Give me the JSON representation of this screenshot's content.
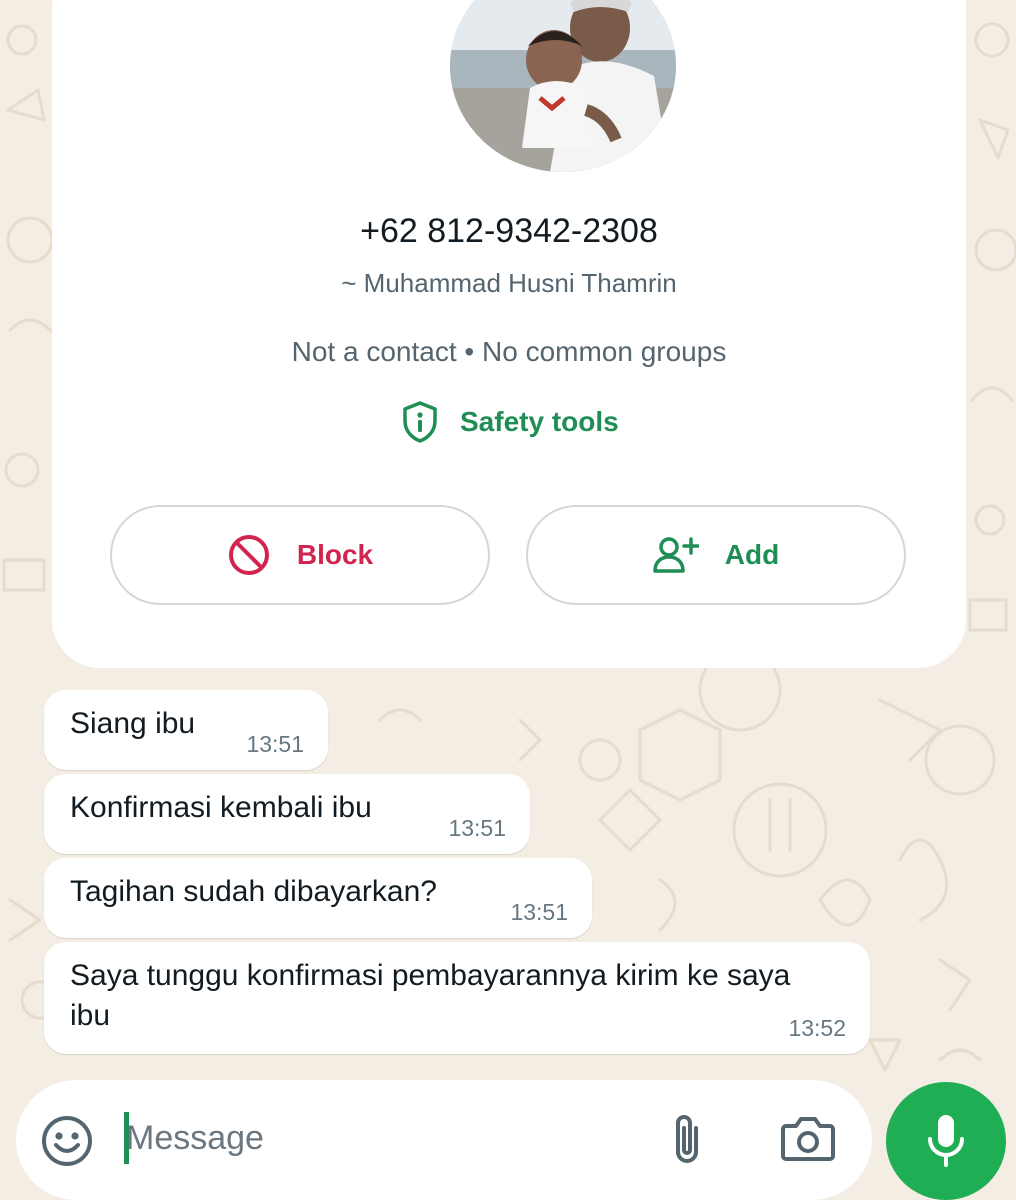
{
  "colors": {
    "wallpaper": "#f3ede4",
    "accent_green": "#1e8e55",
    "block_red": "#d1244f",
    "mic_green": "#1fae53"
  },
  "contact_card": {
    "phone": "+62 812-9342-2308",
    "push_name": "~ Muhammad Husni Thamrin",
    "meta": "Not a contact • No common groups",
    "safety_tools": "Safety tools",
    "safety_icon": "shield-info-icon",
    "block_label": "Block",
    "block_icon": "block-icon",
    "add_label": "Add",
    "add_icon": "add-person-icon"
  },
  "messages": [
    {
      "text": "Siang ibu",
      "time": "13:51"
    },
    {
      "text": "Konfirmasi kembali ibu",
      "time": "13:51"
    },
    {
      "text": "Tagihan sudah dibayarkan?",
      "time": "13:51"
    },
    {
      "text": "Saya tunggu konfirmasi pembayarannya kirim ke saya ibu",
      "time": "13:52"
    }
  ],
  "composer": {
    "placeholder": "Message",
    "emoji_icon": "emoji-icon",
    "attach_icon": "paperclip-icon",
    "camera_icon": "camera-icon",
    "mic_icon": "microphone-icon"
  }
}
